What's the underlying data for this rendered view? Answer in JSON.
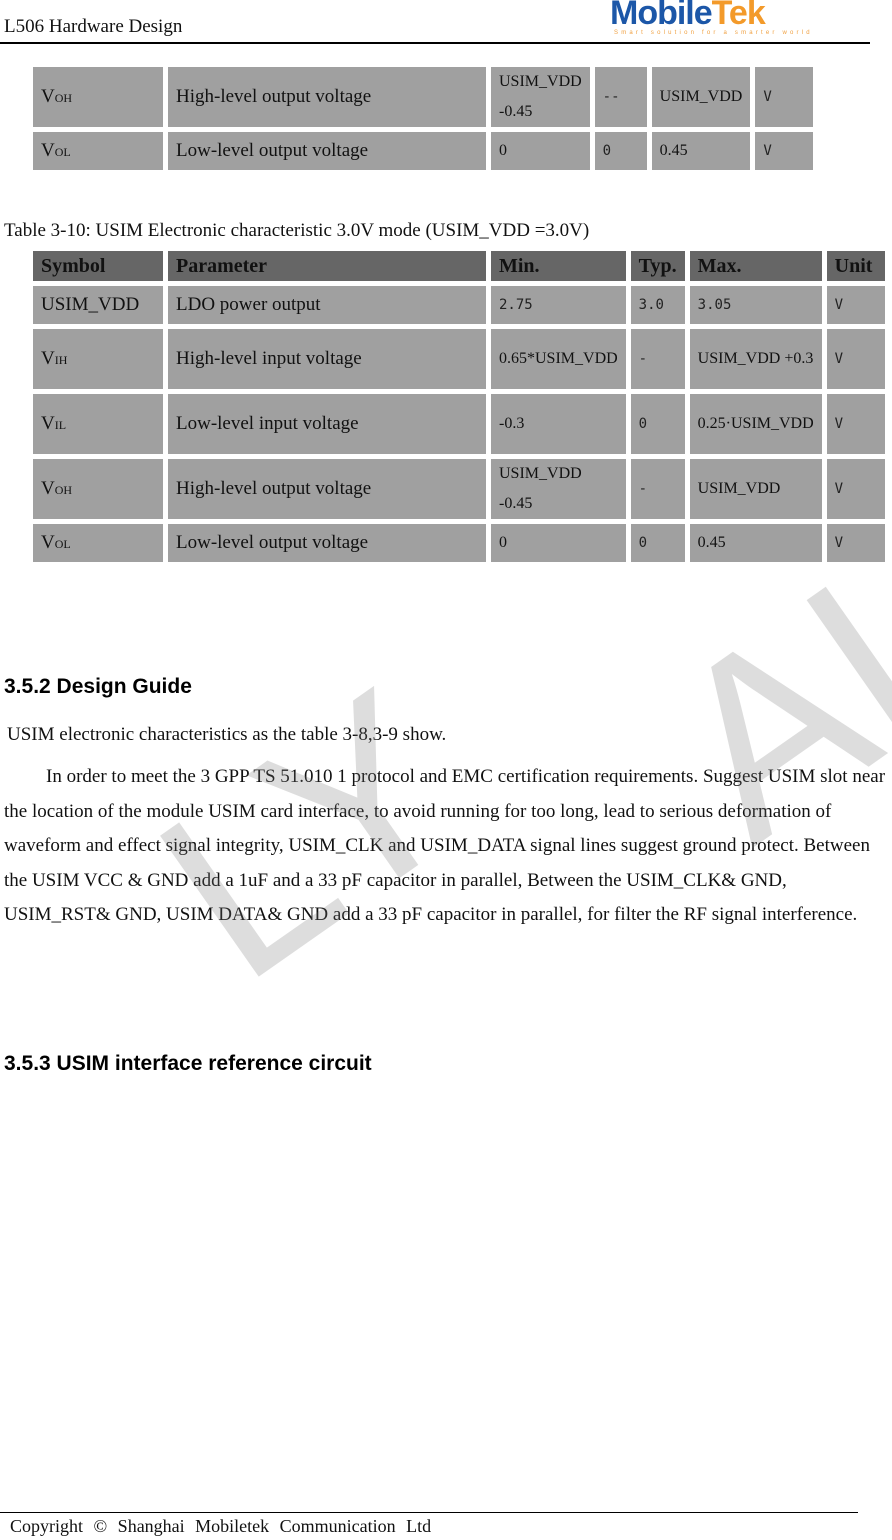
{
  "header": {
    "title": "L506 Hardware Design",
    "logo": {
      "part1": "M",
      "part2": "obile",
      "part3": "Tek",
      "tagline": "Smart solution for a smarter world",
      "colors": {
        "blue": "#1c57a8",
        "orange": "#f39a2a"
      }
    }
  },
  "table_prev": {
    "rows": [
      {
        "symbol": "V",
        "sub": "OH",
        "parameter": "High-level output voltage",
        "min": "USIM_VDD -0.45",
        "typ": "--",
        "max": "USIM_VDD",
        "unit": "V"
      },
      {
        "symbol": "V",
        "sub": "OL",
        "parameter": "Low-level output voltage",
        "min": "0",
        "typ": "0",
        "max": "0.45",
        "unit": "V"
      }
    ]
  },
  "table_3_10": {
    "caption": "Table 3-10: USIM Electronic characteristic 3.0V mode (USIM_VDD =3.0V)",
    "headers": [
      "Symbol",
      "Parameter",
      "Min.",
      "Typ.",
      "Max.",
      "Unit"
    ],
    "rows": [
      {
        "symbol": "USIM_VDD",
        "sub": "",
        "parameter": "LDO power output",
        "min": "2.75",
        "typ": "3.0",
        "max": "3.05",
        "unit": "V"
      },
      {
        "symbol": "V",
        "sub": "IH",
        "parameter": "High-level input voltage",
        "min": "0.65*USIM_VDD",
        "typ": "-",
        "max": "USIM_VDD +0.3",
        "unit": "V"
      },
      {
        "symbol": "V",
        "sub": "IL",
        "parameter": "Low-level input voltage",
        "min": "-0.3",
        "typ": "0",
        "max": "0.25·USIM_VDD",
        "unit": "V"
      },
      {
        "symbol": "V",
        "sub": "OH",
        "parameter": "High-level output voltage",
        "min": "USIM_VDD -0.45",
        "typ": "-",
        "max": "USIM_VDD",
        "unit": "V"
      },
      {
        "symbol": "V",
        "sub": "OL",
        "parameter": "Low-level output voltage",
        "min": "0",
        "typ": "0",
        "max": "0.45",
        "unit": "V"
      }
    ]
  },
  "section_352": {
    "heading": "3.5.2 Design Guide",
    "intro": "USIM electronic characteristics as the table 3-8,3-9 show.",
    "body": "In order to meet the 3 GPP TS 51.010 1 protocol and EMC certification requirements. Suggest USIM slot near the location of the module USIM card interface, to avoid running for too long, lead to serious deformation of waveform and effect signal integrity, USIM_CLK and USIM_DATA signal lines suggest ground protect. Between the USIM VCC & GND add a 1uF and a 33 pF capacitor in parallel, Between the USIM_CLK& GND, USIM_RST& GND, USIM DATA& GND add a 33 pF capacitor in parallel, for filter the RF signal interference."
  },
  "section_353": {
    "heading": "3.5.3 USIM interface reference circuit"
  },
  "watermark": {
    "left": "LY",
    "right": "AL"
  },
  "footer": {
    "copyright": "Copyright © Shanghai Mobiletek Communication Ltd"
  }
}
